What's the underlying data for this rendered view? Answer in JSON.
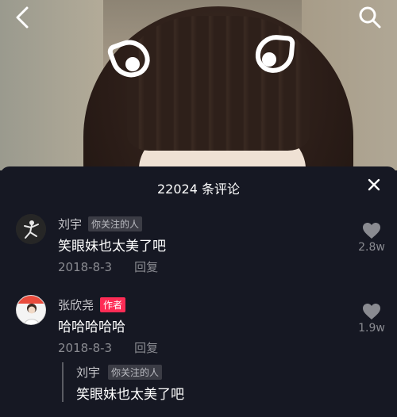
{
  "header": {
    "back_icon": "chevron-left-icon",
    "search_icon": "search-icon"
  },
  "panel": {
    "title": "22024 条评论",
    "close_icon": "close-icon"
  },
  "comments": [
    {
      "username": "刘宇",
      "tag": "你关注的人",
      "text": "笑眼妹也太美了吧",
      "date": "2018-8-3",
      "reply_label": "回复",
      "likes": "2.8w"
    },
    {
      "username": "张欣尧",
      "tag": "作者",
      "text": "哈哈哈哈哈",
      "date": "2018-8-3",
      "reply_label": "回复",
      "likes": "1.9w"
    }
  ],
  "quoted_reply": {
    "username": "刘宇",
    "tag": "你关注的人",
    "text": "笑眼妹也太美了吧"
  },
  "colors": {
    "panel_bg": "#161823",
    "author_tag": "#fe2c55",
    "muted_text": "#8a8b91"
  }
}
